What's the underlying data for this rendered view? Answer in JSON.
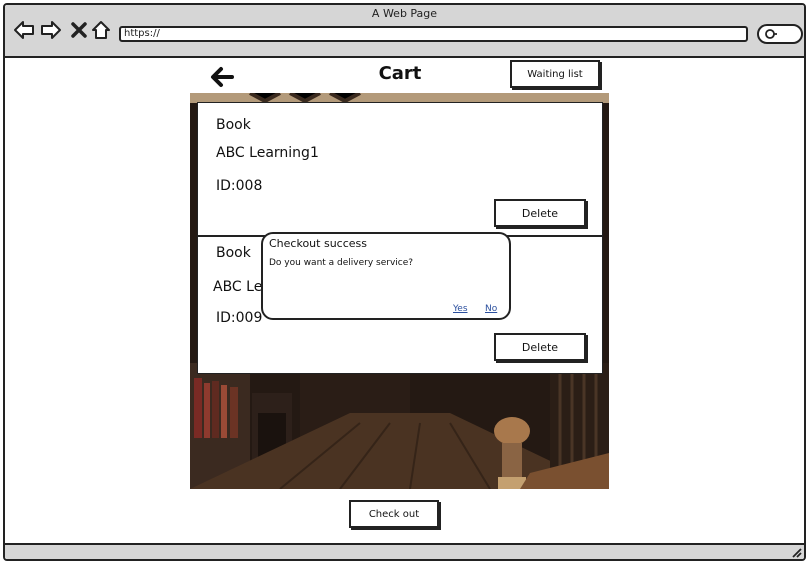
{
  "browser": {
    "page_title": "A Web Page",
    "url": "https://",
    "icons": [
      "back-arrow-icon",
      "forward-arrow-icon",
      "close-icon",
      "home-icon",
      "search-icon"
    ]
  },
  "header": {
    "title": "Cart",
    "waiting_list_label": "Waiting list"
  },
  "cart": {
    "items": [
      {
        "category": "Book",
        "title": "ABC Learning1",
        "id": "ID:008",
        "delete_label": "Delete"
      },
      {
        "category": "Book",
        "title": "ABC Le",
        "id": "ID:009",
        "delete_label": "Delete"
      }
    ]
  },
  "dialog": {
    "title": "Checkout success",
    "message": "Do you want a delivery service?",
    "yes_label": "Yes",
    "no_label": "No"
  },
  "footer": {
    "checkout_label": "Check out"
  },
  "colors": {
    "browser_chrome": "#d6d6d6",
    "link": "#2b4f9e",
    "background_photo": "#2a1d14"
  }
}
